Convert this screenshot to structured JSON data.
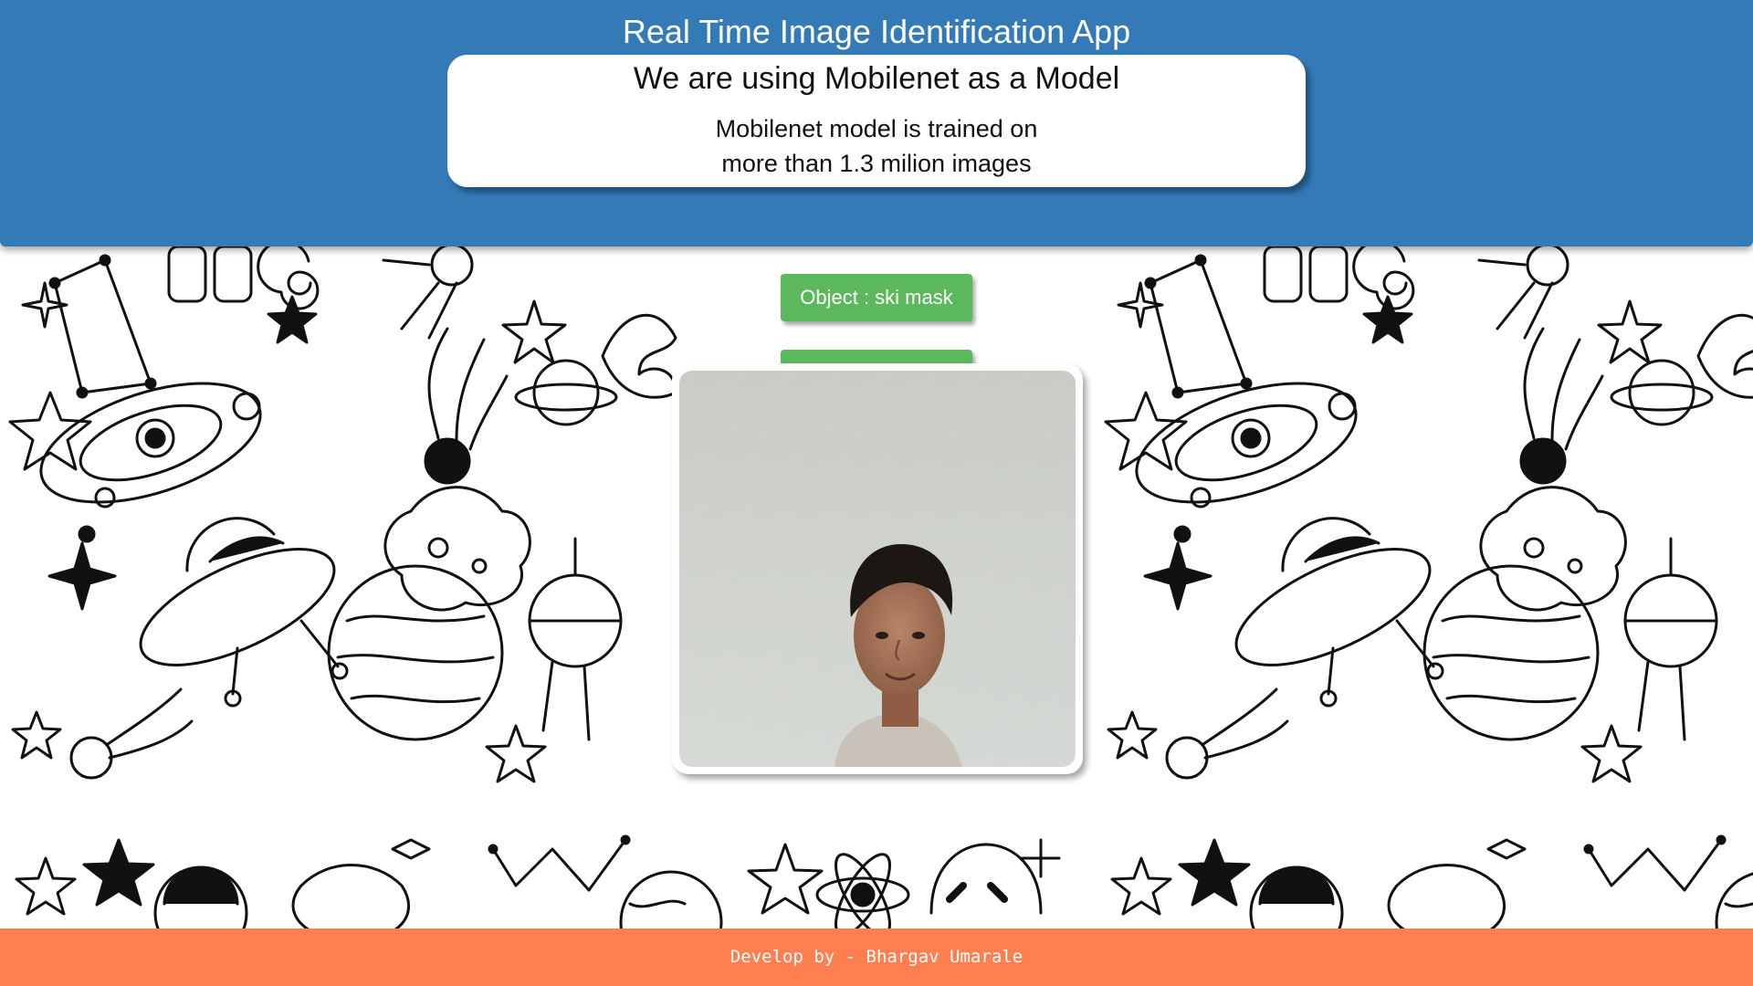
{
  "header": {
    "app_title": "Real Time Image Identification App",
    "model_heading": "We are using Mobilenet as a Model",
    "model_desc_line1": "Mobilenet model is trained on",
    "model_desc_line2": "more than 1.3 milion images"
  },
  "predictions": {
    "object_label": "Object : ski mask",
    "second_label": ""
  },
  "footer": {
    "text": "Develop by - Bhargav Umarale"
  },
  "colors": {
    "header_bg": "#337ab7",
    "prediction_bg": "#5cb85c",
    "footer_bg": "#ff7f50"
  },
  "icons": [
    "space-doodle-background",
    "webcam-feed"
  ]
}
